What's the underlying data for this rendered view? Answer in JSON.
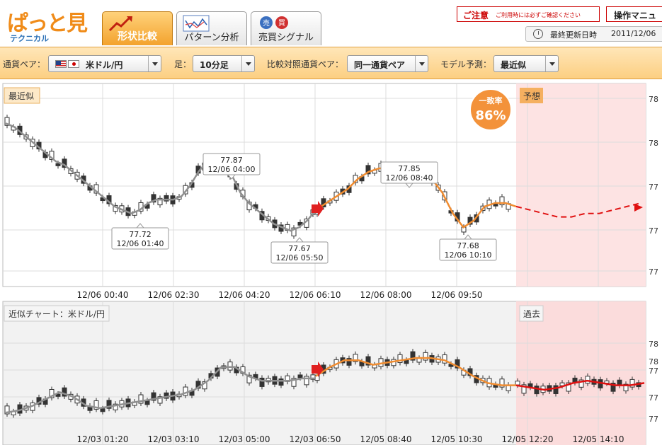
{
  "header": {
    "logo_text": "ぱっと見",
    "logo_sub": "テクニカル",
    "tabs": [
      {
        "label": "形状比較",
        "icon": "shape-compare-icon",
        "active": true
      },
      {
        "label": "パターン分析",
        "icon": "pattern-chart-icon",
        "active": false
      },
      {
        "label": "売買シグナル",
        "icon": "buy-sell-signal-icon",
        "active": false,
        "icon_marks": [
          "売",
          "買"
        ]
      }
    ],
    "notice_title": "ご注意",
    "notice_text": "ご利用時には必ずご確認ください",
    "manual_label": "操作マニュ",
    "updated_label": "最終更新日時",
    "updated_value": "2011/12/06"
  },
  "toolbar": {
    "pair_label": "通貨ペア：",
    "pair_value": "米ドル/円",
    "foot_label": "足：",
    "foot_value": "10分足",
    "compare_label": "比較対照通貨ペア：",
    "compare_value": "同一通貨ペア",
    "model_label": "モデル予測：",
    "model_value": "最近似"
  },
  "top_chart": {
    "label": "最近似",
    "forecast_label": "予想",
    "match_label": "一致率",
    "match_value": "86%",
    "y_ticks": [
      "78",
      "78",
      "77",
      "77",
      "77"
    ],
    "x_labels": [
      "12/06 00:40",
      "12/06 02:30",
      "12/06 04:20",
      "12/06 06:10",
      "12/06 08:00",
      "12/06 09:50"
    ],
    "callouts": [
      {
        "price": "77.72",
        "time": "12/06 01:40"
      },
      {
        "price": "77.87",
        "time": "12/06 04:00"
      },
      {
        "price": "77.67",
        "time": "12/06 05:50"
      },
      {
        "price": "77.85",
        "time": "12/06 08:40"
      },
      {
        "price": "77.68",
        "time": "12/06 10:10"
      }
    ]
  },
  "bottom_chart": {
    "label": "近似チャート：米ドル/円",
    "past_label": "過去",
    "y_ticks": [
      "78",
      "78",
      "77",
      "77",
      "77"
    ],
    "x_labels": [
      "12/03 01:20",
      "12/03 03:10",
      "12/03 05:00",
      "12/03 06:50",
      "12/05 08:40",
      "12/05 10:30",
      "12/05 12:20",
      "12/05 14:10"
    ]
  },
  "chart_data": [
    {
      "type": "line",
      "title": "最近似",
      "xlabel": "",
      "ylabel": "",
      "x_tick_labels": [
        "12/06 00:40",
        "12/06 02:30",
        "12/06 04:20",
        "12/06 06:10",
        "12/06 08:00",
        "12/06 09:50"
      ],
      "ylim": [
        77.55,
        78.05
      ],
      "series": [
        {
          "values": [
            77.98,
            77.97,
            77.95,
            77.93,
            77.91,
            77.89,
            77.87,
            77.86,
            77.84,
            77.82,
            77.8,
            77.78,
            77.76,
            77.74,
            77.73,
            77.72,
            77.73,
            77.75,
            77.76,
            77.76,
            77.76,
            77.77,
            77.8,
            77.84,
            77.87,
            77.87,
            77.85,
            77.83,
            77.78,
            77.75,
            77.73,
            77.71,
            77.69,
            77.68,
            77.67,
            77.68,
            77.7,
            77.73
          ]
        },
        {
          "values": [
            77.73,
            77.75,
            77.77,
            77.79,
            77.82,
            77.84,
            77.85,
            77.85,
            77.84,
            77.84,
            77.83,
            77.82,
            77.78,
            77.72,
            77.68,
            77.7,
            77.74,
            77.75,
            77.75,
            77.74
          ]
        },
        {
          "values": [
            77.74,
            77.73,
            77.72,
            77.71,
            77.71,
            77.72,
            77.72,
            77.73,
            77.74,
            77.75
          ]
        }
      ]
    },
    {
      "type": "line",
      "title": "近似チャート：米ドル/円",
      "xlabel": "",
      "ylabel": "",
      "x_tick_labels": [
        "12/03 01:20",
        "12/03 03:10",
        "12/03 05:00",
        "12/03 06:50",
        "12/05 08:40",
        "12/05 10:30",
        "12/05 12:20",
        "12/05 14:10"
      ],
      "ylim": [
        77.55,
        78.05
      ],
      "series": [
        {
          "values": [
            77.63,
            77.64,
            77.66,
            77.69,
            77.72,
            77.7,
            77.66,
            77.65,
            77.66,
            77.67,
            77.68,
            77.69,
            77.7,
            77.71,
            77.73,
            77.77,
            77.83,
            77.83,
            77.79,
            77.77,
            77.77,
            77.77,
            77.78,
            77.78
          ]
        },
        {
          "values": [
            77.79,
            77.83,
            77.86,
            77.86,
            77.84,
            77.85,
            77.86,
            77.87,
            77.87,
            77.86,
            77.83,
            77.79,
            77.76,
            77.75,
            77.75
          ]
        },
        {
          "values": [
            77.75,
            77.74,
            77.73,
            77.74,
            77.76,
            77.77,
            77.76,
            77.75,
            77.75,
            77.76
          ]
        }
      ]
    }
  ],
  "colors": {
    "accent": "#f08c1a",
    "orange_line": "#f08c30",
    "gray_line": "#888888",
    "red_line": "#e01010",
    "forecast_bg": "#fde3e3",
    "toolbar_bg": "#fcd99a"
  }
}
